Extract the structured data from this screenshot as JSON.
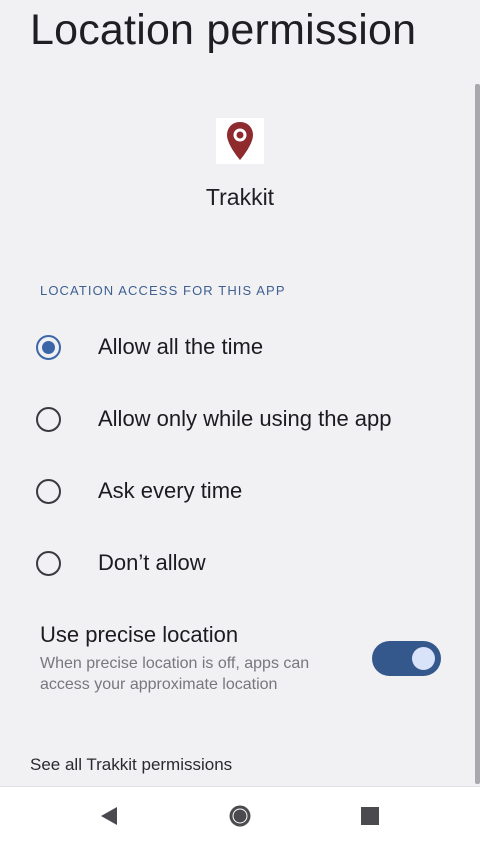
{
  "header": {
    "title": "Location permission"
  },
  "app": {
    "name": "Trakkit",
    "icon": "map-pin-icon",
    "icon_color": "#8f2a2e"
  },
  "section": {
    "label": "LOCATION ACCESS FOR THIS APP"
  },
  "options": [
    {
      "label": "Allow all the time",
      "selected": true
    },
    {
      "label": "Allow only while using the app",
      "selected": false
    },
    {
      "label": "Ask every time",
      "selected": false
    },
    {
      "label": "Don’t allow",
      "selected": false
    }
  ],
  "precise": {
    "title": "Use precise location",
    "description": "When precise location is off, apps can access your approximate location",
    "enabled": true
  },
  "footer": {
    "link": "See all Trakkit permissions"
  },
  "nav": {
    "back": "back-icon",
    "home": "home-icon",
    "recents": "recents-icon"
  },
  "colors": {
    "accent": "#3b67a8",
    "toggle_track": "#34588c",
    "background": "#f1f1f4"
  }
}
